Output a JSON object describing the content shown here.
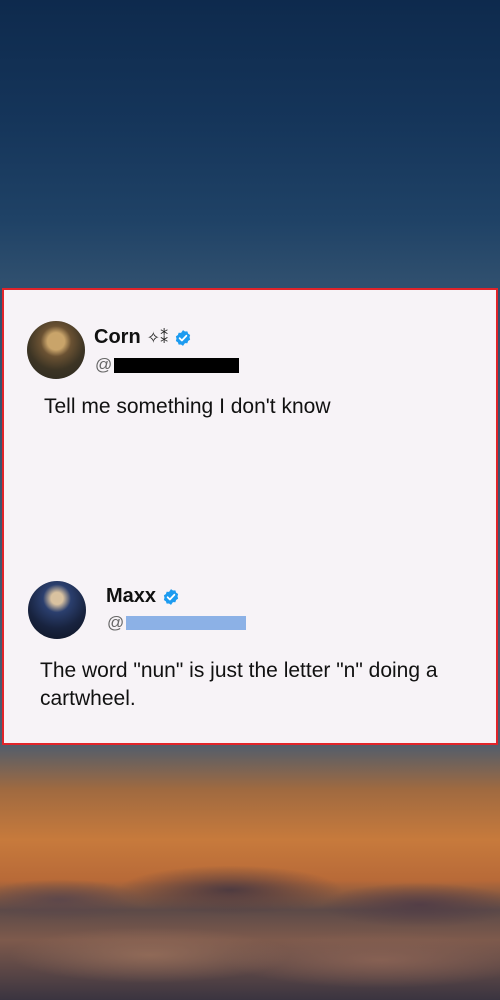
{
  "posts": [
    {
      "name": "Corn",
      "name_decoration": "✧⁑",
      "verified": true,
      "handle_prefix": "@",
      "text": "Tell me something I don't know"
    },
    {
      "name": "Maxx",
      "verified": true,
      "handle_prefix": "@",
      "text": "The word \"nun\" is just the letter \"n\" doing a cartwheel."
    }
  ],
  "colors": {
    "card_background": "#f7f3f7",
    "card_border": "#e0242a",
    "verified_badge": "#1d9bf0"
  },
  "icons": [
    "verified-badge-icon",
    "avatar-image"
  ]
}
